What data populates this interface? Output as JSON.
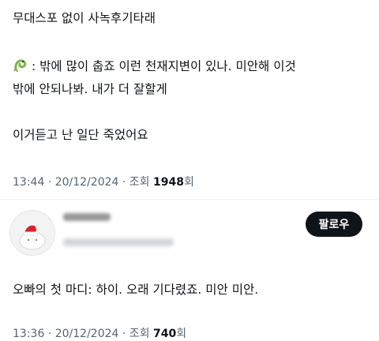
{
  "post1": {
    "line1": "무대스포 없이 사녹후기타래",
    "line2": ": 밖에 많이 춥죠 이런 천재지변이 있나. 미안해 이것",
    "line3": "밖에 안되나봐. 내가 더 잘할게",
    "line4": "이거듣고 난 일단 죽었어요",
    "emoji_icon": "green-dragon-icon",
    "time": "13:44",
    "date": "20/12/2024",
    "views_label": "조회",
    "views_count": "1948",
    "views_suffix": "회"
  },
  "reply": {
    "follow_label": "팔로우",
    "avatar_icon": "santa-hat-mochi-avatar",
    "text": "오빠의 첫 마디: 하이. 오래 기다렸죠. 미안 미안.",
    "time": "13:36",
    "date": "20/12/2024",
    "views_label": "조회",
    "views_count": "740",
    "views_suffix": "회"
  },
  "colors": {
    "text": "#0f1419",
    "muted": "#536471",
    "button": "#0f1419"
  }
}
